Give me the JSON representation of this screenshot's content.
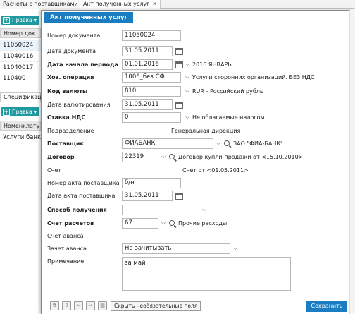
{
  "tabs": [
    {
      "label": "Расчеты с поставщиками"
    },
    {
      "label": "Акт полученных услуг",
      "close": "✕"
    }
  ],
  "background": {
    "edit_button": "Правка",
    "grid_header": "Номер док...",
    "rows": [
      "11050024",
      "11040016",
      "11040017",
      "110400"
    ],
    "subtab": "Спецификаци...",
    "edit_button2": "Правка",
    "grid2_header": "Номенклатура",
    "rows2": [
      "Услуги банка..."
    ]
  },
  "dialog": {
    "title": "Акт полученных услуг",
    "fields": {
      "doc_number": {
        "label": "Номер документа",
        "value": "11050024"
      },
      "doc_date": {
        "label": "Дата документа",
        "value": "31.05.2011"
      },
      "period_start": {
        "label": "Дата начала периода",
        "value": "01.01.2016",
        "info": "2016 ЯНВАРЬ"
      },
      "operation": {
        "label": "Хоз. операция",
        "value": "1006_без СФ",
        "info": "Услуги сторонних организаций. БЕЗ НДС"
      },
      "currency_code": {
        "label": "Код валюты",
        "value": "810",
        "info": "RUR - Российский рубль"
      },
      "valuation_date": {
        "label": "Дата валютирования",
        "value": "31.05.2011"
      },
      "vat_rate": {
        "label": "Ставка НДС",
        "value": "0",
        "info": "Не облагаемые налогом"
      },
      "department": {
        "label": "Подразделение",
        "info": "Генеральная дирекция"
      },
      "supplier": {
        "label": "Поставщик",
        "value": "ФИАБАНК",
        "info": "ЗАО \"ФИА-БАНК\""
      },
      "contract": {
        "label": "Договор",
        "value": "22319",
        "info": "Договор купли-продажи от <15.10.2010>"
      },
      "invoice": {
        "label": "Счет",
        "info": "Счет от <01.05.2011>"
      },
      "supplier_act_number": {
        "label": "Номер акта поставщика",
        "value": "б/н"
      },
      "supplier_act_date": {
        "label": "Дата акта поставщика",
        "value": "31.05.2011"
      },
      "receipt_method": {
        "label": "Способ получения",
        "value": ""
      },
      "settlement_account": {
        "label": "Счет расчетов",
        "value": "67",
        "info": "Прочие расходы"
      },
      "advance_account": {
        "label": "Счет аванса"
      },
      "advance_offset": {
        "label": "Зачет аванса",
        "value": "Не зачитывать"
      },
      "note": {
        "label": "Примечание",
        "value": "за май"
      }
    },
    "footer": {
      "hide_optional": "Скрыть необязательные поля",
      "save": "Сохранить"
    }
  },
  "icons": {
    "calendar": "calendar-icon",
    "search": "search-icon",
    "dropdown": "chevron-down-icon"
  },
  "colors": {
    "accent": "#1a7cc1",
    "teal": "#1f9aa0"
  }
}
